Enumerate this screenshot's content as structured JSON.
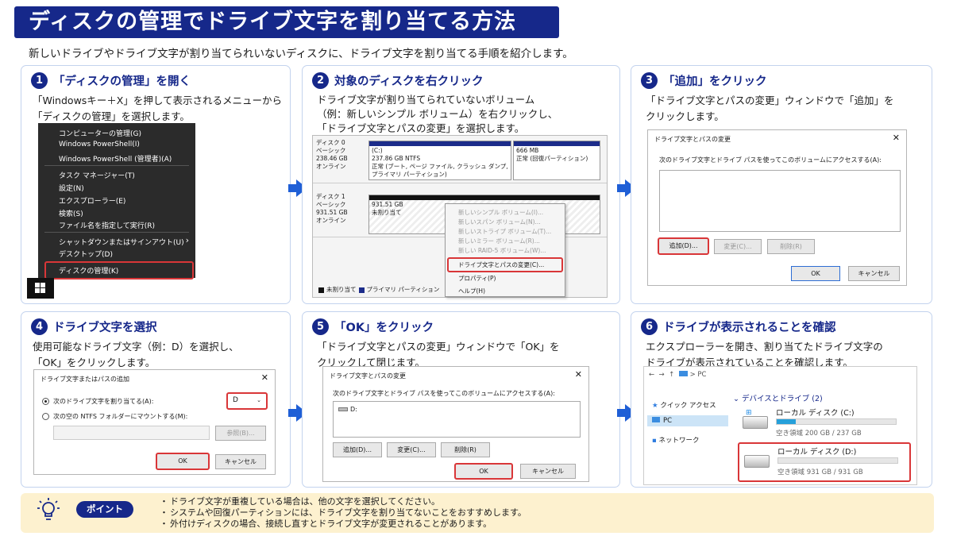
{
  "title": "ディスクの管理でドライブ文字を割り当てる方法",
  "subtitle": "新しいドライブやドライブ文字が割り当てられいないディスクに、ドライブ文字を割り当てる手順を紹介します。",
  "colors": {
    "primary": "#16288a",
    "accent_arrow": "#1f5fd6",
    "highlight": "#d93638",
    "point_bg": "#fdf1cf",
    "card_border": "#c3d3ee"
  },
  "steps": [
    {
      "num": "1",
      "title": "「ディスクの管理」を開く",
      "desc": [
        "「Windowsキー＋X」を押して表示されるメニューから",
        "「ディスクの管理」を選択します。"
      ]
    },
    {
      "num": "2",
      "title": "対象のディスクを右クリック",
      "desc": [
        "ドライブ文字が割り当てられていないボリューム",
        "（例：新しいシンプル ボリューム）を右クリックし、",
        "「ドライブ文字とパスの変更」を選択します。"
      ]
    },
    {
      "num": "3",
      "title": "「追加」をクリック",
      "desc": [
        "「ドライブ文字とパスの変更」ウィンドウで「追加」を",
        "クリックします。"
      ]
    },
    {
      "num": "4",
      "title": "ドライブ文字を選択",
      "desc": [
        "使用可能なドライブ文字（例：D）を選択し、",
        "「OK」をクリックします。"
      ]
    },
    {
      "num": "5",
      "title": "「OK」をクリック",
      "desc": [
        "「ドライブ文字とパスの変更」ウィンドウで「OK」を",
        "クリックして閉じます。"
      ]
    },
    {
      "num": "6",
      "title": "ドライブが表示されることを確認",
      "desc": [
        "エクスプローラーを開き、割り当てたドライブ文字の",
        "ドライブが表示されていることを確認します。"
      ]
    }
  ],
  "startmenu": {
    "items": [
      "コンピューターの管理(G)",
      "Windows PowerShell(I)",
      "Windows PowerShell (管理者)(A)",
      "タスク マネージャー(T)",
      "設定(N)",
      "エクスプローラー(E)",
      "検索(S)",
      "ファイル名を指定して実行(R)",
      "シャットダウンまたはサインアウト(U)",
      "デスクトップ(D)",
      "ディスクの管理(K)"
    ],
    "submenu_arrow": "›"
  },
  "diskmgmt": {
    "disk0": {
      "name": "ディスク 0",
      "type": "ベーシック",
      "size": "238.46 GB",
      "status": "オンライン",
      "p1": {
        "label": "(C:)",
        "size": "237.86 GB NTFS",
        "status": "正常 (ブート, ページ ファイル, クラッシュ ダンプ,",
        "status2": "プライマリ パーティション)"
      },
      "p2": {
        "size": "666 MB",
        "status": "正常 (回復パーティション)"
      }
    },
    "disk1": {
      "name": "ディスク 1",
      "type": "ベーシック",
      "size": "931.51 GB",
      "status": "オンライン",
      "p1": {
        "size": "931.51 GB",
        "status": "未割り当て"
      }
    },
    "context": [
      "新しいシンプル ボリューム(I)...",
      "新しいスパン ボリューム(N)...",
      "新しいストライプ ボリューム(T)...",
      "新しいミラー ボリューム(R)...",
      "新しい RAID-5 ボリューム(W)...",
      "ドライブ文字とパスの変更(C)...",
      "プロパティ(P)",
      "ヘルプ(H)"
    ],
    "legend_unalloc": "未割り当て",
    "legend_primary": "プライマリ パーティション"
  },
  "dlg3": {
    "title": "ドライブ文字とパスの変更",
    "x": "✕",
    "text": "次のドライブ文字とドライブ パスを使ってこのボリュームにアクセスする(A):",
    "add": "追加(D)...",
    "change": "変更(C)...",
    "remove": "削除(R)",
    "ok": "OK",
    "cancel": "キャンセル"
  },
  "dlg4": {
    "title": "ドライブ文字またはパスの追加",
    "x": "✕",
    "radio1": "次のドライブ文字を割り当てる(A):",
    "radio2": "次の空の NTFS フォルダーにマウントする(M):",
    "letter": "D",
    "browse": "参照(B)...",
    "ok": "OK",
    "cancel": "キャンセル"
  },
  "dlg5": {
    "title": "ドライブ文字とパスの変更",
    "x": "✕",
    "text": "次のドライブ文字とドライブ パスを使ってこのボリュームにアクセスする(A):",
    "entry": "D:",
    "add": "追加(D)...",
    "change": "変更(C)...",
    "remove": "削除(R)",
    "ok": "OK",
    "cancel": "キャンセル"
  },
  "explorer": {
    "nav_back": "←",
    "nav_fwd": "→",
    "nav_up": "↑",
    "path": "PC",
    "quick": "クイック アクセス",
    "pc": "PC",
    "network": "ネットワーク",
    "section": "デバイスとドライブ (2)",
    "drives": [
      {
        "name": "ローカル ディスク (C:)",
        "free": "空き領域 200 GB / 237 GB",
        "used_fraction": 0.16
      },
      {
        "name": "ローカル ディスク (D:)",
        "free": "空き領域 931 GB / 931 GB",
        "used_fraction": 0.0
      }
    ]
  },
  "point": {
    "badge": "ポイント",
    "items": [
      "ドライブ文字が重複している場合は、他の文字を選択してください。",
      "システムや回復パーティションには、ドライブ文字を割り当てないことをおすすめします。",
      "外付けディスクの場合、接続し直すとドライブ文字が変更されることがあります。"
    ]
  }
}
